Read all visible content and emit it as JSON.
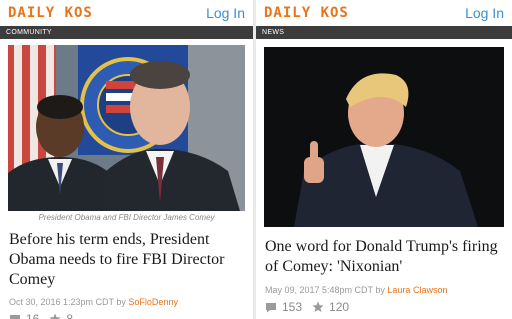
{
  "left": {
    "logo": "DAILY KOS",
    "login": "Log In",
    "section": "COMMUNITY",
    "caption": "President Obama and FBI Director James Comey",
    "headline": "Before his term ends, President Obama needs to fire FBI Director Comey",
    "meta_date": "Oct 30, 2016 1:23pm CDT by",
    "author": "SoFloDenny",
    "comments": "16",
    "recommends": "8"
  },
  "right": {
    "logo": "DAILY KOS",
    "login": "Log In",
    "section": "NEWS",
    "headline": "One word for Donald Trump's firing of Comey: 'Nixonian'",
    "meta_date": "May 09, 2017 5:48pm CDT by",
    "author": "Laura Clawson",
    "comments": "153",
    "recommends": "120"
  },
  "colors": {
    "brand": "#e8751a",
    "link": "#3a8fd4",
    "section_bar": "#3c3c3c"
  },
  "icons": {
    "comments": "comment-bubble-icon",
    "recommends": "star-icon"
  }
}
